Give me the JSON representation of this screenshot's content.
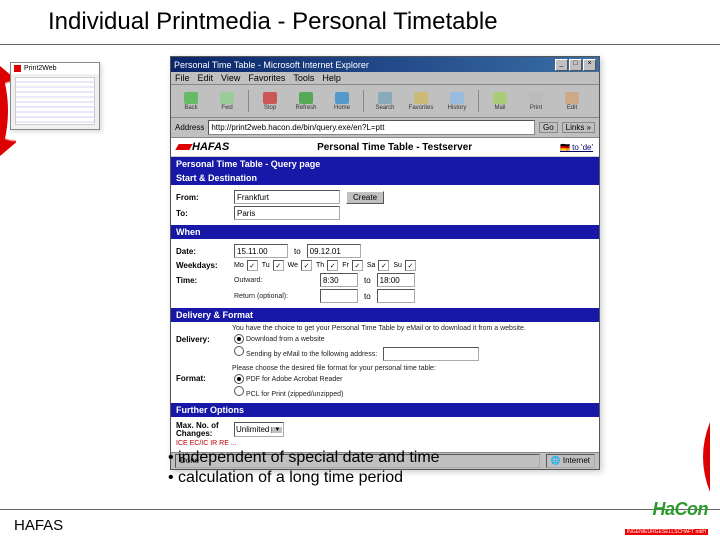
{
  "slide": {
    "title": "Individual Printmedia - Personal Timetable",
    "bullets": [
      "• independent of special date and time",
      "• calculation of a long time period"
    ],
    "footer_left": "HAFAS",
    "footer_brand": "HaCon",
    "footer_sub": "INGENIEURGESELLSCHAFT mbH",
    "thumb_label": "Print2Web"
  },
  "browser": {
    "title": "Personal Time Table - Microsoft Internet Explorer",
    "win_buttons": {
      "min": "_",
      "max": "□",
      "close": "×"
    },
    "menu": [
      "File",
      "Edit",
      "View",
      "Favorites",
      "Tools",
      "Help"
    ],
    "toolbar": [
      "Back",
      "Fwd",
      "Stop",
      "Refresh",
      "Home",
      "Search",
      "Favorites",
      "History",
      "Mail",
      "Print",
      "Edit"
    ],
    "address_label": "Address",
    "address_value": "http://print2web.hacon.de/bin/query.exe/en?L=ptt",
    "go": "Go",
    "links": "Links »",
    "status_done": "Done",
    "status_zone": "Internet"
  },
  "page": {
    "brand": "HAFAS",
    "page_title": "Personal Time Table - Testserver",
    "lang_link": "to 'de'",
    "h_query": "Personal Time Table - Query page",
    "h_startdest": "Start & Destination",
    "from_label": "From:",
    "from_value": "Frankfurt",
    "to_label": "To:",
    "to_value": "Paris",
    "create_btn": "Create",
    "h_when": "When",
    "date_label": "Date:",
    "date_value": "15.11.00",
    "date_to": "to",
    "date_end": "09.12.01",
    "weekdays_label": "Weekdays:",
    "days": [
      "Mo",
      "Tu",
      "We",
      "Th",
      "Fr",
      "Sa",
      "Su"
    ],
    "checked": "✓",
    "time_label": "Time:",
    "outward": "Outward:",
    "return": "Return (optional):",
    "t1": "8:30",
    "t_to": "to",
    "t2": "18:00",
    "h_delivery": "Delivery & Format",
    "del_intro": "You have the choice to get your Personal Time Table by eMail or to download it from a website.",
    "delivery_label": "Delivery:",
    "opt_download": "Download from a website",
    "opt_email": "Sending by eMail to the following address:",
    "format_intro": "Please choose the desired file format for your personal time table:",
    "format_label": "Format:",
    "opt_pdf": "PDF for Adobe Acrobat Reader",
    "opt_pcl": "PCL for Print (zipped/unzipped)",
    "h_further": "Further Options",
    "maxchg_label": "Max. No. of Changes:",
    "maxchg_value": "Unlimited",
    "products_row": "ICE  EC/IC  IR  RE  ..."
  }
}
